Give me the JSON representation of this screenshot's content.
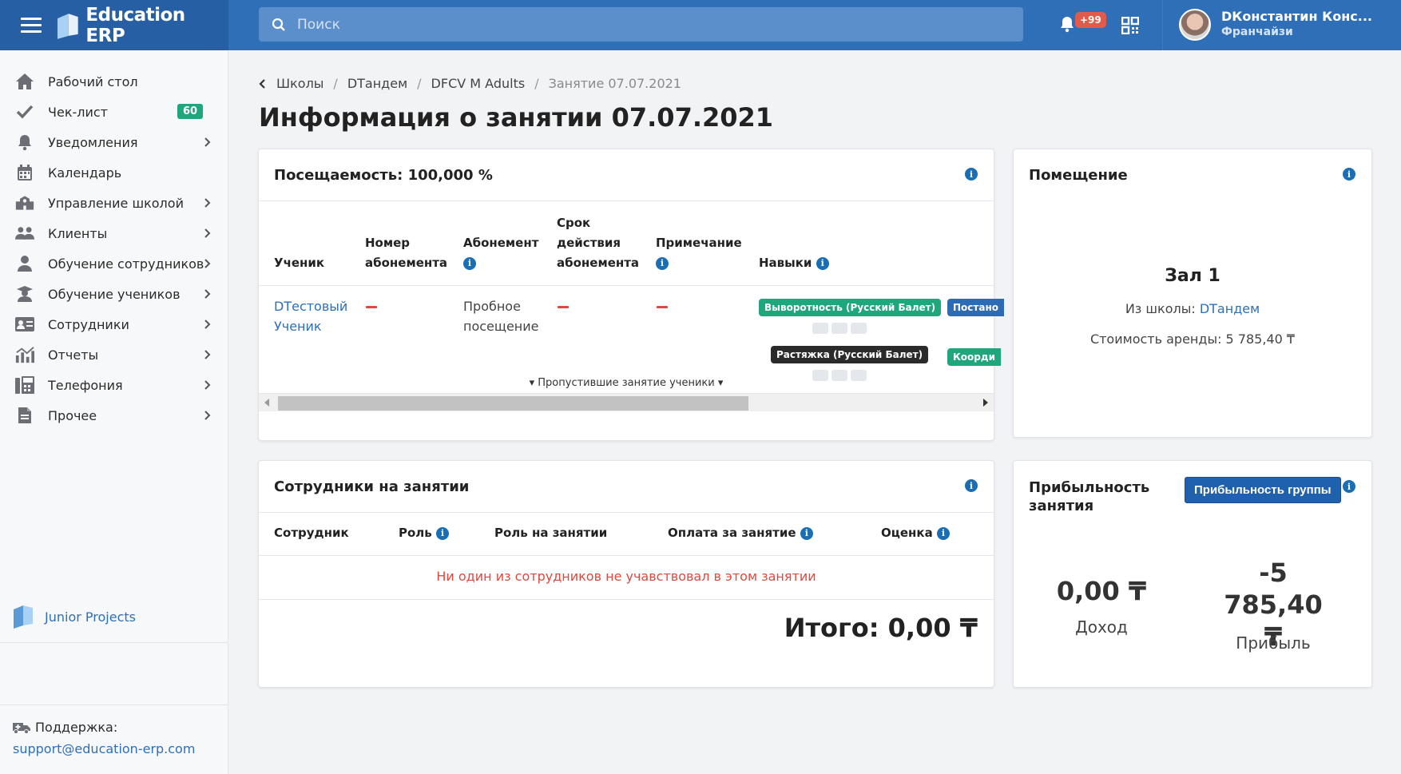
{
  "app": {
    "brand": "Education ERP"
  },
  "search": {
    "placeholder": "Поиск"
  },
  "header": {
    "notif_count": "+99",
    "user_name": "DКонстантин Конс...",
    "user_role": "Франчайзи"
  },
  "sidebar": {
    "items": [
      {
        "label": "Рабочий стол"
      },
      {
        "label": "Чек-лист",
        "badge": "60"
      },
      {
        "label": "Уведомления"
      },
      {
        "label": "Календарь"
      },
      {
        "label": "Управление школой"
      },
      {
        "label": "Клиенты"
      },
      {
        "label": "Обучение сотрудников"
      },
      {
        "label": "Обучение учеников"
      },
      {
        "label": "Сотрудники"
      },
      {
        "label": "Отчеты"
      },
      {
        "label": "Телефония"
      },
      {
        "label": "Прочее"
      }
    ],
    "junior_projects": "Junior Projects",
    "support_title": "Поддержка:",
    "support_email": "support@education-erp.com"
  },
  "breadcrumb": [
    "Школы",
    "DТандем",
    "DFCV M Adults",
    "Занятие 07.07.2021"
  ],
  "page_title": "Информация о занятии 07.07.2021",
  "attendance": {
    "title": "Посещаемость: 100,000 %",
    "headers": {
      "student": "Ученик",
      "number_l1": "Номер",
      "number_l2": "абонемента",
      "subscription": "Абонемент",
      "validity_l1": "Срок",
      "validity_l2": "действия",
      "validity_l3": "абонемента",
      "note": "Примечание",
      "skills": "Навыки"
    },
    "row": {
      "student_l1": "DТестовый",
      "student_l2": "Ученик",
      "subscription_l1": "Пробное",
      "subscription_l2": "посещение",
      "skills": [
        "Выворотность (Русский Балет)",
        "Постано",
        "Растяжка (Русский Балет)",
        "Коорди"
      ]
    },
    "missed_toggle": "▾ Пропустившие занятие ученики ▾"
  },
  "room": {
    "title": "Помещение",
    "name": "Зал 1",
    "school_label": "Из школы:",
    "school_link": "DТандем",
    "rent": "Стоимость аренды: 5 785,40 ₸"
  },
  "staff": {
    "title": "Сотрудники на занятии",
    "headers": {
      "employee": "Сотрудник",
      "role": "Роль",
      "lesson_role": "Роль на занятии",
      "payment": "Оплата за занятие",
      "rating": "Оценка"
    },
    "empty": "Ни один из сотрудников не учавствовал в этом занятии",
    "total": "Итого: 0,00 ₸"
  },
  "profit": {
    "title_l1": "Прибыльность",
    "title_l2": "занятия",
    "button": "Прибыльность группы",
    "income_value": "0,00 ₸",
    "income_label": "Доход",
    "profit_value_l1": "-5 785,40",
    "profit_value_l2": "₸",
    "profit_label": "Прибыль"
  },
  "colors": {
    "header_bg": "#2e6fb8",
    "accent": "#1f61ad",
    "badge_green": "#1fa67a",
    "danger": "#e0483e",
    "skill_green": "#1fa67a",
    "skill_blue": "#2d6bb5",
    "skill_dark": "#2b2b2b"
  }
}
